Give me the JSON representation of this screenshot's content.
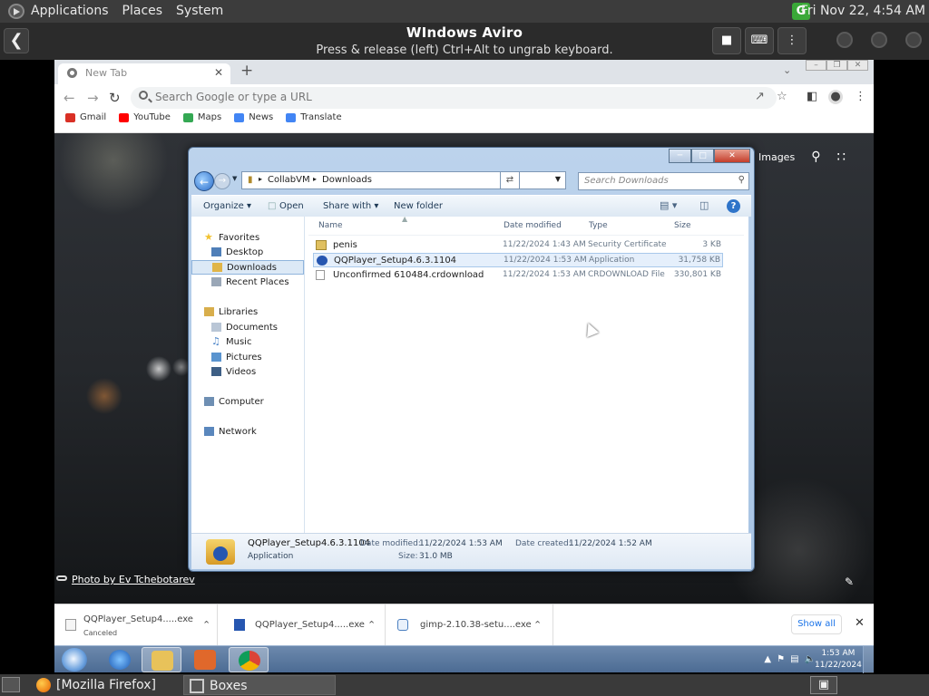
{
  "topbar": {
    "menu": [
      "Applications",
      "Places",
      "System"
    ],
    "tray_badge": "G",
    "clock": "Fri Nov 22,  4:54 AM"
  },
  "boxes": {
    "title": "WIndows Aviro",
    "subtitle": "Press & release (left) Ctrl+Alt to ungrab keyboard.",
    "back_icon": "arrow-left-icon",
    "buttons": [
      "stop-icon",
      "keyboard-icon",
      "menu-dots-icon"
    ]
  },
  "browser": {
    "tab_label": "New Tab",
    "new_tab": "+",
    "omnibox_placeholder": "Search Google or type a URL",
    "bookmarks": [
      {
        "label": "Gmail",
        "color": "#d93025"
      },
      {
        "label": "YouTube",
        "color": "#ff0000"
      },
      {
        "label": "Maps",
        "color": "#34a853"
      },
      {
        "label": "News",
        "color": "#4285f4"
      },
      {
        "label": "Translate",
        "color": "#4285f4"
      }
    ],
    "google_links": [
      "Images"
    ],
    "photo_credit": "Photo by Ev Tchebotarev",
    "downloads": [
      {
        "name": "QQPlayer_Setup4.....exe",
        "status": "Canceled"
      },
      {
        "name": "QQPlayer_Setup4.....exe",
        "status": ""
      },
      {
        "name": "gimp-2.10.38-setu....exe",
        "status": ""
      }
    ],
    "show_all": "Show all"
  },
  "explorer": {
    "path": [
      "CollabVM",
      "Downloads"
    ],
    "search_placeholder": "Search Downloads",
    "commands": [
      "Organize ▾",
      "Open",
      "Share with ▾",
      "New folder"
    ],
    "nav": [
      {
        "label": "Favorites",
        "icon": "star-icon",
        "color": "#f2c230"
      },
      {
        "label": "Desktop",
        "icon": "desktop-icon",
        "color": "#4f7fb8"
      },
      {
        "label": "Downloads",
        "icon": "downloads-folder-icon",
        "color": "#e0b548",
        "selected": true
      },
      {
        "label": "Recent Places",
        "icon": "recent-places-icon",
        "color": "#9aa7b7"
      },
      {
        "label": "Libraries",
        "icon": "libraries-icon",
        "color": "#d8ae4c"
      },
      {
        "label": "Documents",
        "icon": "documents-icon",
        "color": "#b9c6d6"
      },
      {
        "label": "Music",
        "icon": "music-icon",
        "color": "#4c85c9"
      },
      {
        "label": "Pictures",
        "icon": "pictures-icon",
        "color": "#5a94cf"
      },
      {
        "label": "Videos",
        "icon": "videos-icon",
        "color": "#3e5f85"
      },
      {
        "label": "Computer",
        "icon": "computer-icon",
        "color": "#6e8fb3"
      },
      {
        "label": "Network",
        "icon": "network-icon",
        "color": "#5a87bd"
      }
    ],
    "columns": [
      "Name",
      "Date modified",
      "Type",
      "Size"
    ],
    "files": [
      {
        "name": "penis",
        "date": "11/22/2024 1:43 AM",
        "type": "Security Certificate",
        "size": "3 KB",
        "icon": "certificate-icon",
        "color": "#e0c060"
      },
      {
        "name": "QQPlayer_Setup4.6.3.1104",
        "date": "11/22/2024 1:53 AM",
        "type": "Application",
        "size": "31,758 KB",
        "icon": "qqplayer-app-icon",
        "color": "#2656b0"
      },
      {
        "name": "Unconfirmed 610484.crdownload",
        "date": "11/22/2024 1:53 AM",
        "type": "CRDOWNLOAD File",
        "size": "330,801 KB",
        "icon": "blank-file-icon",
        "color": "#ffffff"
      }
    ],
    "details": {
      "name": "QQPlayer_Setup4.6.3.1104",
      "type": "Application",
      "modified_label": "Date modified:",
      "modified": "11/22/2024 1:53 AM",
      "created_label": "Date created:",
      "created": "11/22/2024 1:52 AM",
      "size_label": "Size:",
      "size": "31.0 MB"
    }
  },
  "win7_taskbar": {
    "time": "1:53 AM",
    "date": "11/22/2024"
  },
  "host_taskbar": {
    "items": [
      "[Mozilla Firefox]",
      "Boxes"
    ]
  }
}
